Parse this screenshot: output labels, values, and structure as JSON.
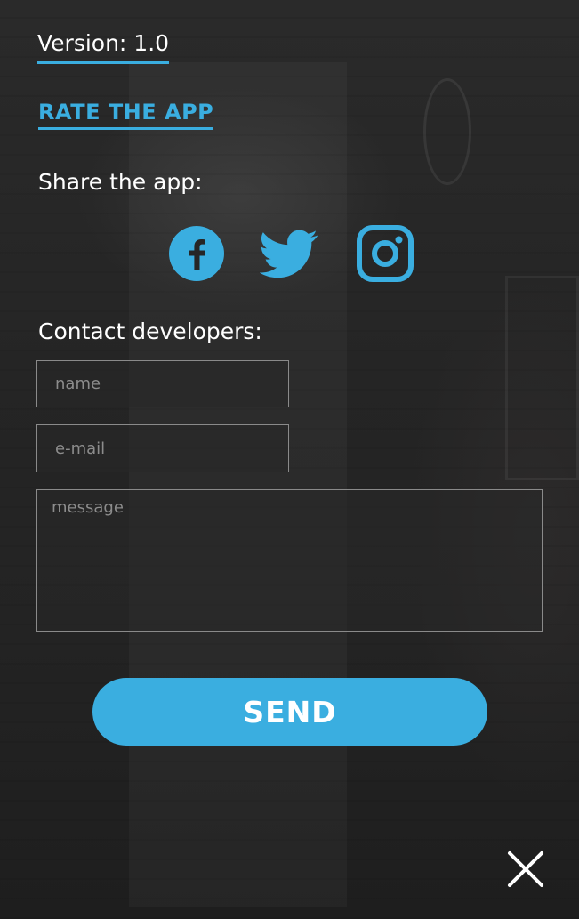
{
  "about": {
    "version_text": "Version: 1.0",
    "rate_label": "RATE THE APP"
  },
  "share": {
    "label": "Share the app:",
    "icons": [
      "facebook-icon",
      "twitter-icon",
      "instagram-icon"
    ]
  },
  "contact": {
    "label": "Contact developers:",
    "name_placeholder": "name",
    "email_placeholder": "e-mail",
    "message_placeholder": "message",
    "name_value": "",
    "email_value": "",
    "message_value": ""
  },
  "actions": {
    "send_label": "SEND",
    "close_icon": "close-icon"
  },
  "colors": {
    "accent": "#3aaee0",
    "text": "#ffffff",
    "placeholder": "#8c8c8c",
    "background": "#262626"
  }
}
